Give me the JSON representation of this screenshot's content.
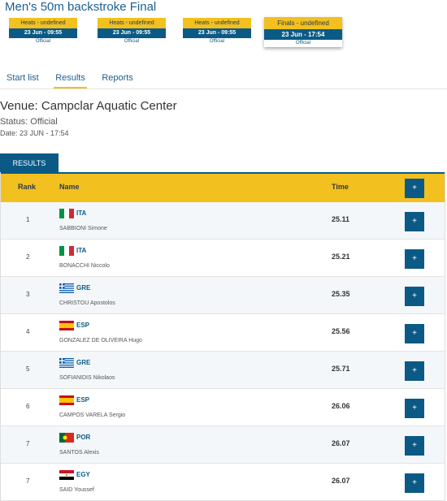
{
  "title": "Men's 50m backstroke Final",
  "phases": [
    {
      "label": "Heats - undefined",
      "datetime": "23 Jun - 09:55",
      "status": "Official",
      "active": false
    },
    {
      "label": "Heats - undefined",
      "datetime": "23 Jun - 09:55",
      "status": "Official",
      "active": false
    },
    {
      "label": "Heats - undefined",
      "datetime": "23 Jun - 09:55",
      "status": "Official",
      "active": false
    },
    {
      "label": "Finals - undefined",
      "datetime": "23 Jun - 17:54",
      "status": "Official",
      "active": true
    }
  ],
  "tabs": [
    {
      "label": "Start list",
      "active": false
    },
    {
      "label": "Results",
      "active": true
    },
    {
      "label": "Reports",
      "active": false
    }
  ],
  "venue": "Venue: Campclar Aquatic Center",
  "status": "Status: Official",
  "date": "Date: 23 JUN - 17:54",
  "results_tab": "RESULTS",
  "table": {
    "headers": {
      "rank": "Rank",
      "name": "Name",
      "time": "Time"
    },
    "header_button": "+",
    "rows": [
      {
        "rank": "1",
        "nat": "ITA",
        "flag": "italy-flag-icon",
        "name": "SABBIONI Simone",
        "time": "25.11",
        "button": "+"
      },
      {
        "rank": "2",
        "nat": "ITA",
        "flag": "italy-flag-icon",
        "name": "BONACCHI Niccolo",
        "time": "25.21",
        "button": "+"
      },
      {
        "rank": "3",
        "nat": "GRE",
        "flag": "greece-flag-icon",
        "name": "CHRISTOU Apostolos",
        "time": "25.35",
        "button": "+"
      },
      {
        "rank": "4",
        "nat": "ESP",
        "flag": "spain-flag-icon",
        "name": "GONZALEZ DE OLIVEIRA Hugo",
        "time": "25.56",
        "button": "+"
      },
      {
        "rank": "5",
        "nat": "GRE",
        "flag": "greece-flag-icon",
        "name": "SOFIANIDIS Nikolaos",
        "time": "25.71",
        "button": "+"
      },
      {
        "rank": "6",
        "nat": "ESP",
        "flag": "spain-flag-icon",
        "name": "CAMPOS VARELA Sergio",
        "time": "26.06",
        "button": "+"
      },
      {
        "rank": "7",
        "nat": "POR",
        "flag": "portugal-flag-icon",
        "name": "SANTOS Alexis",
        "time": "26.07",
        "button": "+"
      },
      {
        "rank": "7",
        "nat": "EGY",
        "flag": "egypt-flag-icon",
        "name": "SAID Youssef",
        "time": "26.07",
        "button": "+"
      }
    ]
  },
  "colors": {
    "primary": "#0b5a86",
    "accent": "#f2c01f",
    "title": "#1d5f8f"
  }
}
